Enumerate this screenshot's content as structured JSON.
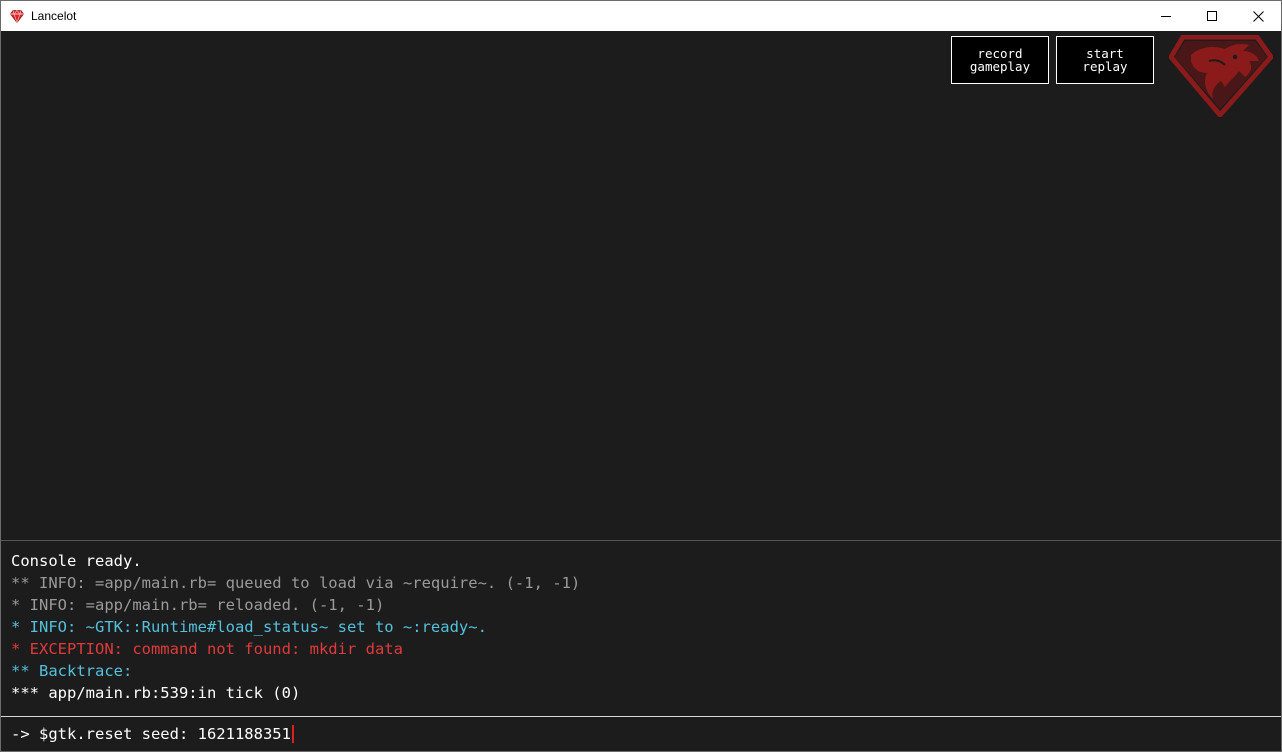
{
  "window": {
    "title": "Lancelot",
    "icon": "ruby-gem-icon"
  },
  "game": {
    "record_button": {
      "line1": "record",
      "line2": "gameplay"
    },
    "replay_button": {
      "line1": "start",
      "line2": "replay"
    },
    "logo": "dragon-logo",
    "logo_color": "#8b1a1a"
  },
  "console": {
    "lines": [
      {
        "text": "Console ready.",
        "color": "#ffffff"
      },
      {
        "text": "** INFO: =app/main.rb= queued to load via ~require~. (-1, -1)",
        "color": "#9a9a9a"
      },
      {
        "text": "* INFO: =app/main.rb= reloaded. (-1, -1)",
        "color": "#9a9a9a"
      },
      {
        "text": "* INFO: ~GTK::Runtime#load_status~ set to ~:ready~.",
        "color": "#53c1dc"
      },
      {
        "text": "* EXCEPTION: command not found: mkdir data",
        "color": "#e03a3a"
      },
      {
        "text": "** Backtrace:",
        "color": "#53c1dc"
      },
      {
        "text": "*** app/main.rb:539:in tick (0)",
        "color": "#ffffff"
      }
    ]
  },
  "prompt": {
    "text": "-> $gtk.reset seed: 1621188351",
    "caret_color": "#e02020"
  }
}
